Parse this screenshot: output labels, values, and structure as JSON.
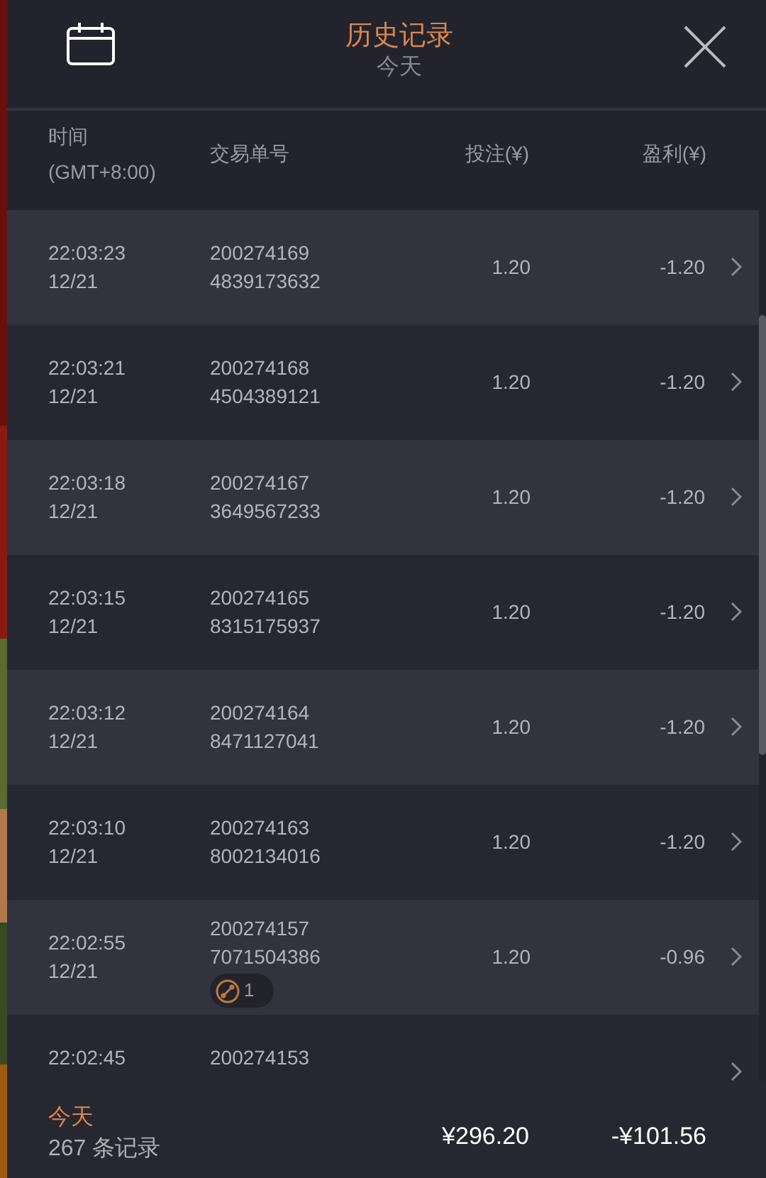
{
  "header": {
    "title": "历史记录",
    "subtitle": "今天"
  },
  "columns": [
    "时间",
    "(GMT+8:00)",
    "交易单号",
    "投注(¥)",
    "盈利(¥)"
  ],
  "rows": [
    {
      "time": "22:03:23",
      "date": "12/21",
      "order": "200274169",
      "order_2": "4839173632",
      "stake": "1.20",
      "profit": "-1.20",
      "win": false
    },
    {
      "time": "22:03:21",
      "date": "12/21",
      "order": "200274168",
      "order_2": "4504389121",
      "stake": "1.20",
      "profit": "-1.20",
      "win": false
    },
    {
      "time": "22:03:18",
      "date": "12/21",
      "order": "200274167",
      "order_2": "3649567233",
      "stake": "1.20",
      "profit": "-1.20",
      "win": false
    },
    {
      "time": "22:03:15",
      "date": "12/21",
      "order": "200274165",
      "order_2": "8315175937",
      "stake": "1.20",
      "profit": "-1.20",
      "win": false
    },
    {
      "time": "22:03:12",
      "date": "12/21",
      "order": "200274164",
      "order_2": "8471127041",
      "stake": "1.20",
      "profit": "-1.20",
      "win": false
    },
    {
      "time": "22:03:10",
      "date": "12/21",
      "order": "200274163",
      "order_2": "8002134016",
      "stake": "1.20",
      "profit": "-1.20",
      "win": false
    },
    {
      "time": "22:02:55",
      "date": "12/21",
      "order": "200274157",
      "order_2": "7071504386",
      "badge": "1",
      "stake": "1.20",
      "profit": "-0.96",
      "win": false
    },
    {
      "time": "22:02:45",
      "order": "200274153"
    }
  ],
  "footer": {
    "label": "今天",
    "count": "267 条记录",
    "stake_total": "¥296.20",
    "profit_total": "-¥101.56"
  }
}
